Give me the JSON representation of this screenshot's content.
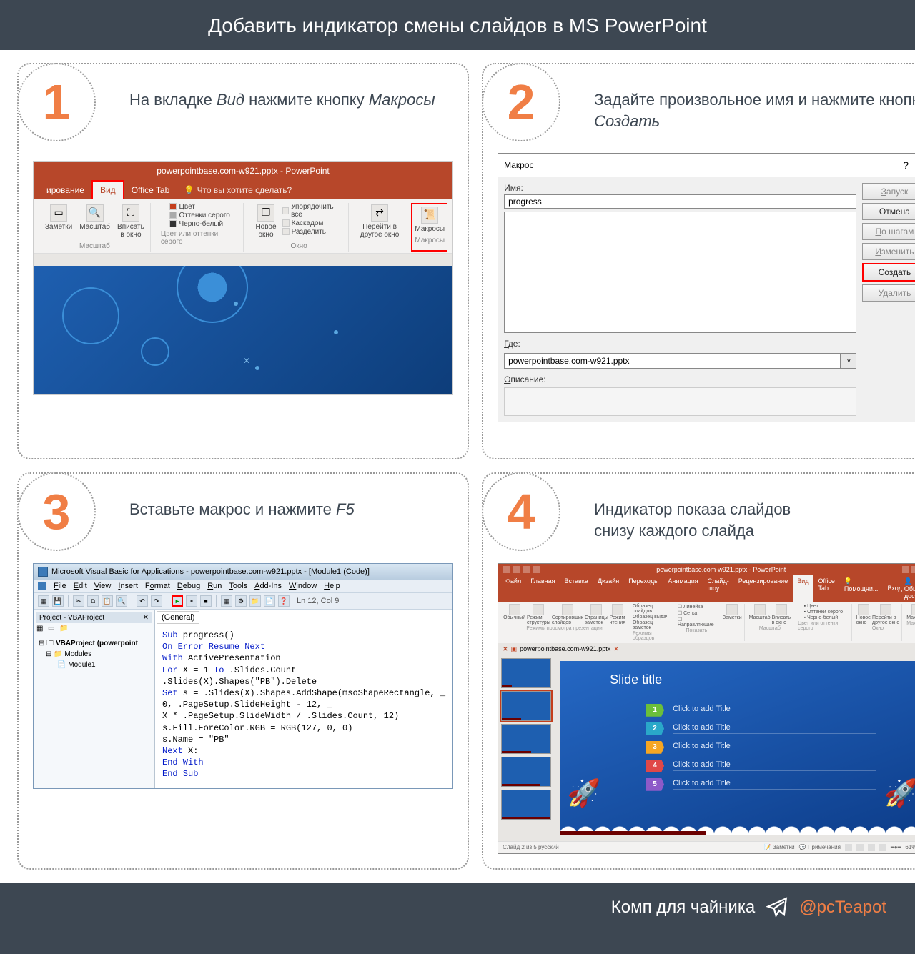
{
  "header": {
    "title": "Добавить индикатор смены слайдов в MS PowerPoint"
  },
  "steps": {
    "s1": {
      "num": "1",
      "text_pre": "На вкладке ",
      "text_em1": "Вид",
      "text_mid": " нажмите кнопку ",
      "text_em2": "Макросы"
    },
    "s2": {
      "num": "2",
      "text_pre": "Задайте произвольное имя и нажмите кнопку ",
      "text_em1": "Создать"
    },
    "s3": {
      "num": "3",
      "text_pre": "Вставьте макрос и нажмите ",
      "text_em1": "F5"
    },
    "s4": {
      "num": "4",
      "text_line1": "Индикатор показа слайдов",
      "text_line2": "снизу каждого слайда"
    }
  },
  "ppt1": {
    "title": "powerpointbase.com-w921.pptx - PowerPoint",
    "tabs": {
      "left": "ирование",
      "active": "Вид",
      "office": "Office Tab",
      "help": "Что вы хотите сделать?"
    },
    "groups": {
      "zoom": {
        "name": "Масштаб",
        "b1": "Заметки",
        "b2": "Масштаб",
        "b3": "Вписать\nв окно"
      },
      "color": {
        "name": "Цвет или оттенки серого",
        "i1": "Цвет",
        "i2": "Оттенки серого",
        "i3": "Черно-белый"
      },
      "window": {
        "name": "Окно",
        "b1": "Новое\nокно",
        "i1": "Упорядочить все",
        "i2": "Каскадом",
        "i3": "Разделить"
      },
      "move": {
        "name": "",
        "b1": "Перейти в\nдругое окно"
      },
      "macros": {
        "name": "Макросы",
        "b1": "Макросы"
      }
    }
  },
  "dlg": {
    "title": "Макрос",
    "name_label": "Имя:",
    "name_value": "progress",
    "where_label": "Где:",
    "where_value": "powerpointbase.com-w921.pptx",
    "desc_label": "Описание:",
    "buttons": {
      "run": "Запуск",
      "cancel": "Отмена",
      "step": "По шагам",
      "edit": "Изменить",
      "create": "Создать",
      "delete": "Удалить"
    }
  },
  "vba": {
    "title": "Microsoft Visual Basic for Applications - powerpointbase.com-w921.pptx - [Module1 (Code)]",
    "menu": {
      "file": "File",
      "edit": "Edit",
      "view": "View",
      "insert": "Insert",
      "format": "Format",
      "debug": "Debug",
      "run": "Run",
      "tools": "Tools",
      "addins": "Add-Ins",
      "window": "Window",
      "help": "Help"
    },
    "cursor": "Ln 12, Col 9",
    "project_header": "Project - VBAProject",
    "project_root": "VBAProject (powerpoint",
    "project_modules": "Modules",
    "project_module1": "Module1",
    "dd_general": "(General)",
    "code": {
      "l1": "Sub progress()",
      "l2": "On Error Resume Next",
      "l3": "With ActivePresentation",
      "l4": "For X = 1 To .Slides.Count",
      "l5": ".Slides(X).Shapes(\"PB\").Delete",
      "l6": "Set s = .Slides(X).Shapes.AddShape(msoShapeRectangle, _",
      "l7": "0, .PageSetup.SlideHeight - 12, _",
      "l8": "X * .PageSetup.SlideWidth / .Slides.Count, 12)",
      "l9": "s.Fill.ForeColor.RGB = RGB(127, 0, 0)",
      "l10": "s.Name = \"PB\"",
      "l11": "Next X:",
      "l12": "End With",
      "l13": "End Sub"
    }
  },
  "ppt4": {
    "title": "powerpointbase.com-w921.pptx - PowerPoint",
    "tabs": {
      "file": "Файл",
      "home": "Главная",
      "insert": "Вставка",
      "design": "Дизайн",
      "transitions": "Переходы",
      "animations": "Анимация",
      "slideshow": "Слайд-шоу",
      "review": "Рецензирование",
      "view": "Вид",
      "office": "Office Tab",
      "help": "Помощни...",
      "signin": "Вход",
      "share": "Общий доступ"
    },
    "ribbon_groups": {
      "g1": "Режимы просмотра презентации",
      "g2": "Режимы образцов",
      "g3": "Показать",
      "g4": "Масштаб",
      "g5": "Цвет или оттенки серого",
      "g6": "Окно",
      "g7": "Макросы"
    },
    "ribbon_items": {
      "normal": "Обычный",
      "outline": "Режим\nструктуры",
      "sorter": "Сортировщик\nслайдов",
      "notes_page": "Страницы\nзаметок",
      "reading": "Режим\nчтения",
      "slide_master": "Образец слайдов",
      "handout_master": "Образец выдач",
      "notes_master": "Образец заметок",
      "ruler": "Линейка",
      "gridlines": "Сетка",
      "guides": "Направляющие",
      "notes_btn": "Заметки",
      "zoom": "Масштаб",
      "fit": "Вписать\nв окно",
      "color": "Цвет",
      "gray": "Оттенки серого",
      "bw": "Черно-белый",
      "newwin": "Новое\nокно",
      "switch": "Перейти в\nдругое окно",
      "macros": "Макросы"
    },
    "docbar": "powerpointbase.com-w921.pptx",
    "slide_title": "Slide title",
    "agenda_item": "Click to add Title",
    "agenda_nums": [
      "1",
      "2",
      "3",
      "4",
      "5"
    ],
    "status": {
      "left": "Слайд 2 из 5    русский",
      "notes": "Заметки",
      "comments": "Примечания",
      "zoom": "61%"
    }
  },
  "footer": {
    "text": "Комп для чайника",
    "handle": "@pcTeapot"
  }
}
